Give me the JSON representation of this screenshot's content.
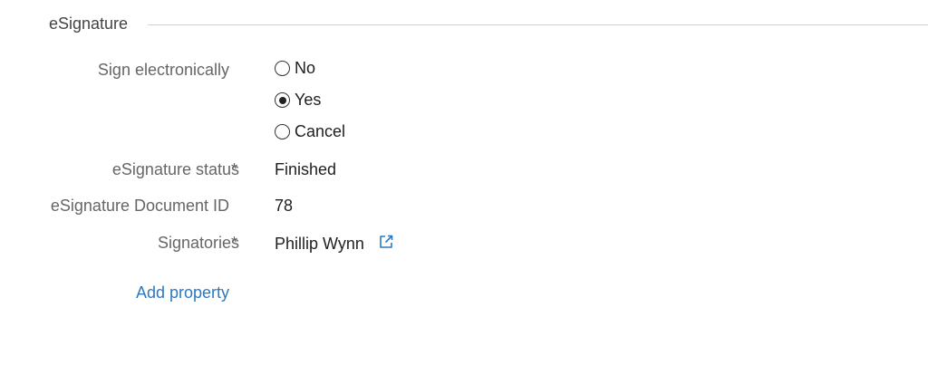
{
  "section": {
    "title": "eSignature"
  },
  "sign_electronically": {
    "label": "Sign electronically",
    "options": [
      {
        "label": "No",
        "selected": false
      },
      {
        "label": "Yes",
        "selected": true
      },
      {
        "label": "Cancel",
        "selected": false
      }
    ]
  },
  "status": {
    "label": "eSignature status",
    "required_mark": "*",
    "value": "Finished"
  },
  "document_id": {
    "label": "eSignature Document ID",
    "value": "78"
  },
  "signatories": {
    "label": "Signatories",
    "required_mark": "*",
    "value": "Phillip Wynn",
    "link_icon": "external-link-icon"
  },
  "add_property": {
    "label": "Add property"
  },
  "colors": {
    "link": "#2b79c2",
    "label": "#666666",
    "value": "#1f1f1f"
  }
}
